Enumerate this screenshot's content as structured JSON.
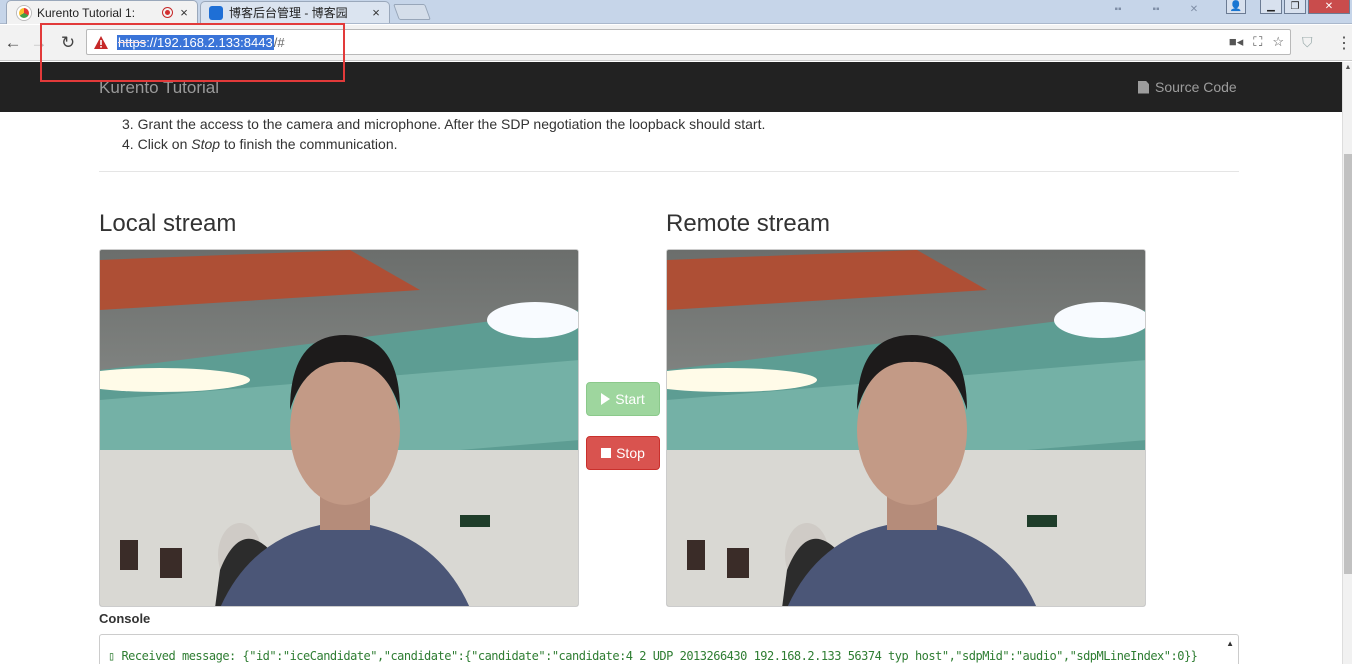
{
  "browser": {
    "tabs": [
      {
        "title": "Kurento Tutorial 1: ",
        "active": true,
        "recording": true
      },
      {
        "title": "博客后台管理 - 博客园",
        "active": false
      }
    ],
    "tab_close_glyph": "×",
    "address": {
      "url_selected_scheme": "https",
      "url_selected_host": "://192.168.2.133:8443",
      "url_rest": "/#"
    }
  },
  "navbar": {
    "brand": "Kurento Tutorial",
    "source_link": "Source Code"
  },
  "instructions": {
    "step3": "Grant the access to the camera and microphone. After the SDP negotiation the loopback should start.",
    "step4_before": "Click on ",
    "step4_emph": "Stop",
    "step4_after": " to finish the communication.",
    "step3_num": "3.",
    "step4_num": "4."
  },
  "streams": {
    "local_title": "Local stream",
    "remote_title": "Remote stream"
  },
  "buttons": {
    "start_label": "Start",
    "stop_label": "Stop"
  },
  "console": {
    "label": "Console",
    "lines": [
      "Received message: {\"id\":\"iceCandidate\",\"candidate\":{\"candidate\":\"candidate:4 2 UDP 2013266430 192.168.2.133 56374 typ host\",\"sdpMid\":\"audio\",\"sdpMLineIndex\":0}}"
    ]
  },
  "colors": {
    "navbar_bg": "#222222",
    "start_button": "#9ed69e",
    "stop_button": "#d9534f",
    "console_text": "#2e7d32",
    "highlight_box": "#e23a3a"
  }
}
